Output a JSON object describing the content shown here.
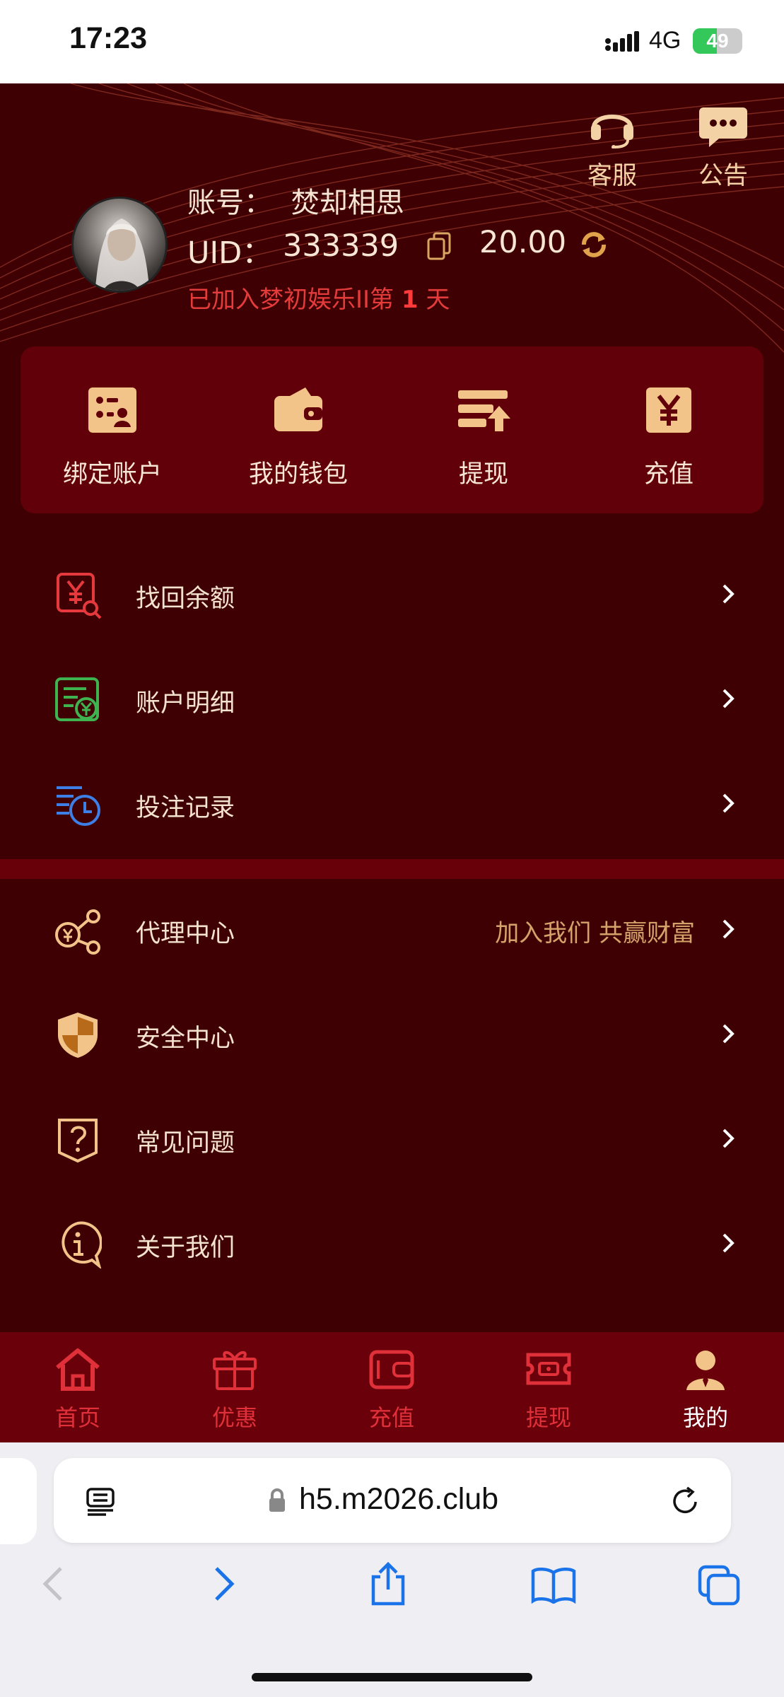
{
  "status_bar": {
    "time": "17:23",
    "network": "4G",
    "battery": "49",
    "battery_level": 0.49
  },
  "header": {
    "support_label": "客服",
    "notice_label": "公告",
    "account_label": "账号：",
    "account_name": "焚却相思",
    "uid_label": "UID：",
    "uid_value": "333339",
    "balance": "20.00",
    "joined_prefix": "已加入梦初娱乐II第",
    "joined_days": "1",
    "joined_suffix": "天"
  },
  "quick_actions": [
    {
      "label": "绑定账户",
      "icon": "bind-account-icon"
    },
    {
      "label": "我的钱包",
      "icon": "wallet-icon"
    },
    {
      "label": "提现",
      "icon": "withdraw-icon"
    },
    {
      "label": "充值",
      "icon": "recharge-icon"
    }
  ],
  "menu_group_1": [
    {
      "label": "找回余额",
      "icon": "recover-balance-icon",
      "icon_color": "#e5393e"
    },
    {
      "label": "账户明细",
      "icon": "account-details-icon",
      "icon_color": "#3fb34f"
    },
    {
      "label": "投注记录",
      "icon": "bet-record-icon",
      "icon_color": "#3d7fe6"
    }
  ],
  "menu_group_2": [
    {
      "label": "代理中心",
      "icon": "agent-center-icon",
      "extra": "加入我们 共赢财富"
    },
    {
      "label": "安全中心",
      "icon": "security-shield-icon"
    },
    {
      "label": "常见问题",
      "icon": "faq-icon"
    },
    {
      "label": "关于我们",
      "icon": "about-info-icon"
    }
  ],
  "tabs": [
    {
      "label": "首页",
      "icon": "home-icon"
    },
    {
      "label": "优惠",
      "icon": "gift-icon"
    },
    {
      "label": "充值",
      "icon": "recharge-card-icon"
    },
    {
      "label": "提现",
      "icon": "withdraw-ticket-icon"
    },
    {
      "label": "我的",
      "icon": "user-icon",
      "active": true
    }
  ],
  "browser": {
    "url": "h5.m2026.club"
  },
  "colors": {
    "background": "#3f0003",
    "card": "#620009",
    "gold": "#f3c48a",
    "accent_red": "#e0303a"
  }
}
